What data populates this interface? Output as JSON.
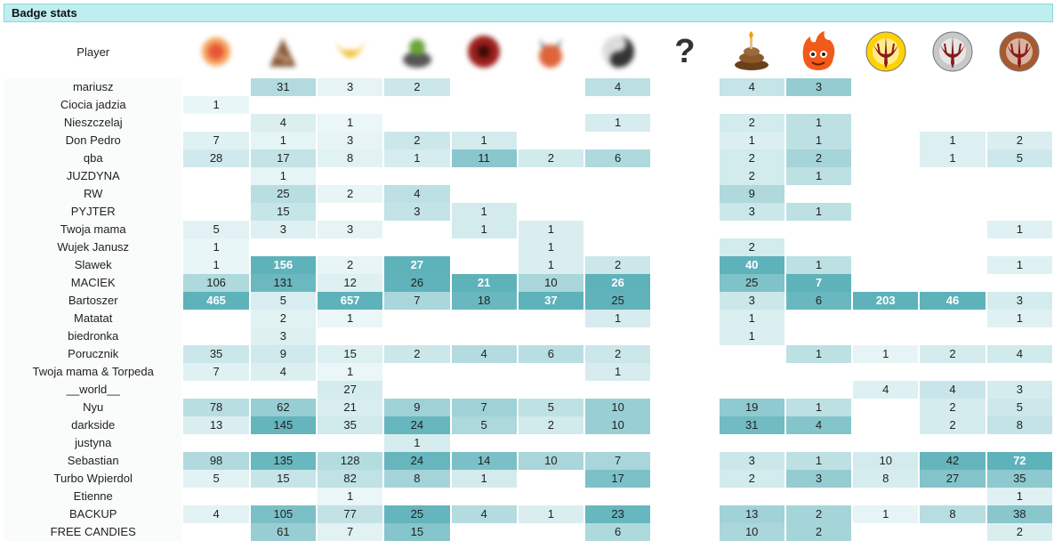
{
  "panel_title": "Badge stats",
  "table": {
    "player_header": "Player",
    "badges": [
      {
        "icon": "blurred-badge-red-orange",
        "color": "#e9553a"
      },
      {
        "icon": "blurred-badge-brown-pile",
        "color": "#8a5a3a"
      },
      {
        "icon": "blurred-badge-yellow-wings",
        "color": "#f2c23a"
      },
      {
        "icon": "blurred-badge-green-gray",
        "color": "#6aa43a"
      },
      {
        "icon": "blurred-badge-dark-red-ball",
        "color": "#9a1f1a"
      },
      {
        "icon": "blurred-badge-orange-creature",
        "color": "#e0643a"
      },
      {
        "icon": "blurred-badge-black-swirl",
        "color": "#333333"
      },
      {
        "icon": "question-mark-icon",
        "text": "?"
      },
      {
        "icon": "poop-candle-icon",
        "color": "#8b5a2b"
      },
      {
        "icon": "fire-devil-icon",
        "color": "#f25a1a"
      },
      {
        "icon": "quake-logo-gold-icon",
        "color": "#ffd200"
      },
      {
        "icon": "quake-logo-silver-icon",
        "color": "#c8c8c8"
      },
      {
        "icon": "quake-logo-bronze-icon",
        "color": "#a85a2e"
      }
    ],
    "rows": [
      {
        "player": "mariusz",
        "cells": [
          "",
          "31",
          "3",
          "2",
          "",
          "",
          "4",
          "",
          "4",
          "3",
          "",
          "",
          ""
        ]
      },
      {
        "player": "Ciocia jadzia",
        "cells": [
          "1",
          "",
          "",
          "",
          "",
          "",
          "",
          "",
          "",
          "",
          "",
          "",
          ""
        ]
      },
      {
        "player": "Nieszczelaj",
        "cells": [
          "",
          "4",
          "1",
          "",
          "",
          "",
          "1",
          "",
          "2",
          "1",
          "",
          "",
          ""
        ]
      },
      {
        "player": "Don Pedro",
        "cells": [
          "7",
          "1",
          "3",
          "2",
          "1",
          "",
          "",
          "",
          "1",
          "1",
          "",
          "1",
          "2"
        ]
      },
      {
        "player": "qba",
        "cells": [
          "28",
          "17",
          "8",
          "1",
          "11",
          "2",
          "6",
          "",
          "2",
          "2",
          "",
          "1",
          "5"
        ]
      },
      {
        "player": "JUZDYNA",
        "cells": [
          "",
          "1",
          "",
          "",
          "",
          "",
          "",
          "",
          "2",
          "1",
          "",
          "",
          ""
        ]
      },
      {
        "player": "RW",
        "cells": [
          "",
          "25",
          "2",
          "4",
          "",
          "",
          "",
          "",
          "9",
          "",
          "",
          "",
          ""
        ]
      },
      {
        "player": "PYJTER",
        "cells": [
          "",
          "15",
          "",
          "3",
          "1",
          "",
          "",
          "",
          "3",
          "1",
          "",
          "",
          ""
        ]
      },
      {
        "player": "Twoja mama",
        "cells": [
          "5",
          "3",
          "3",
          "",
          "1",
          "1",
          "",
          "",
          "",
          "",
          "",
          "",
          "1"
        ]
      },
      {
        "player": "Wujek Janusz",
        "cells": [
          "1",
          "",
          "",
          "",
          "",
          "1",
          "",
          "",
          "2",
          "",
          "",
          "",
          ""
        ]
      },
      {
        "player": "Slawek",
        "cells": [
          "1",
          "156",
          "2",
          "27",
          "",
          "1",
          "2",
          "",
          "40",
          "1",
          "",
          "",
          "1"
        ]
      },
      {
        "player": "MACIEK",
        "cells": [
          "106",
          "131",
          "12",
          "26",
          "21",
          "10",
          "26",
          "",
          "25",
          "7",
          "",
          "",
          ""
        ]
      },
      {
        "player": "Bartoszer",
        "cells": [
          "465",
          "5",
          "657",
          "7",
          "18",
          "37",
          "25",
          "",
          "3",
          "6",
          "203",
          "46",
          "3"
        ]
      },
      {
        "player": "Matatat",
        "cells": [
          "",
          "2",
          "1",
          "",
          "",
          "",
          "1",
          "",
          "1",
          "",
          "",
          "",
          "1"
        ]
      },
      {
        "player": "biedronka",
        "cells": [
          "",
          "3",
          "",
          "",
          "",
          "",
          "",
          "",
          "1",
          "",
          "",
          "",
          ""
        ]
      },
      {
        "player": "Porucznik",
        "cells": [
          "35",
          "9",
          "15",
          "2",
          "4",
          "6",
          "2",
          "",
          "",
          "1",
          "1",
          "2",
          "4"
        ]
      },
      {
        "player": "Twoja mama & Torpeda",
        "cells": [
          "7",
          "4",
          "1",
          "",
          "",
          "",
          "1",
          "",
          "",
          "",
          "",
          "",
          ""
        ]
      },
      {
        "player": "__world__",
        "cells": [
          "",
          "",
          "27",
          "",
          "",
          "",
          "",
          "",
          "",
          "",
          "4",
          "4",
          "3"
        ]
      },
      {
        "player": "Nyu",
        "cells": [
          "78",
          "62",
          "21",
          "9",
          "7",
          "5",
          "10",
          "",
          "19",
          "1",
          "",
          "2",
          "5"
        ]
      },
      {
        "player": "darkside",
        "cells": [
          "13",
          "145",
          "35",
          "24",
          "5",
          "2",
          "10",
          "",
          "31",
          "4",
          "",
          "2",
          "8"
        ]
      },
      {
        "player": "justyna",
        "cells": [
          "",
          "",
          "",
          "1",
          "",
          "",
          "",
          "",
          "",
          "",
          "",
          "",
          ""
        ]
      },
      {
        "player": "Sebastian",
        "cells": [
          "98",
          "135",
          "128",
          "24",
          "14",
          "10",
          "7",
          "",
          "3",
          "1",
          "10",
          "42",
          "72"
        ]
      },
      {
        "player": "Turbo Wpierdol",
        "cells": [
          "5",
          "15",
          "82",
          "8",
          "1",
          "",
          "17",
          "",
          "2",
          "3",
          "8",
          "27",
          "35"
        ]
      },
      {
        "player": "Etienne",
        "cells": [
          "",
          "",
          "1",
          "",
          "",
          "",
          "",
          "",
          "",
          "",
          "",
          "",
          "1"
        ]
      },
      {
        "player": "BACKUP",
        "cells": [
          "4",
          "105",
          "77",
          "25",
          "4",
          "1",
          "23",
          "",
          "13",
          "2",
          "1",
          "8",
          "38"
        ]
      },
      {
        "player": "FREE CANDIES",
        "cells": [
          "",
          "61",
          "7",
          "15",
          "",
          "",
          "6",
          "",
          "10",
          "2",
          "",
          "",
          "2"
        ]
      }
    ]
  }
}
